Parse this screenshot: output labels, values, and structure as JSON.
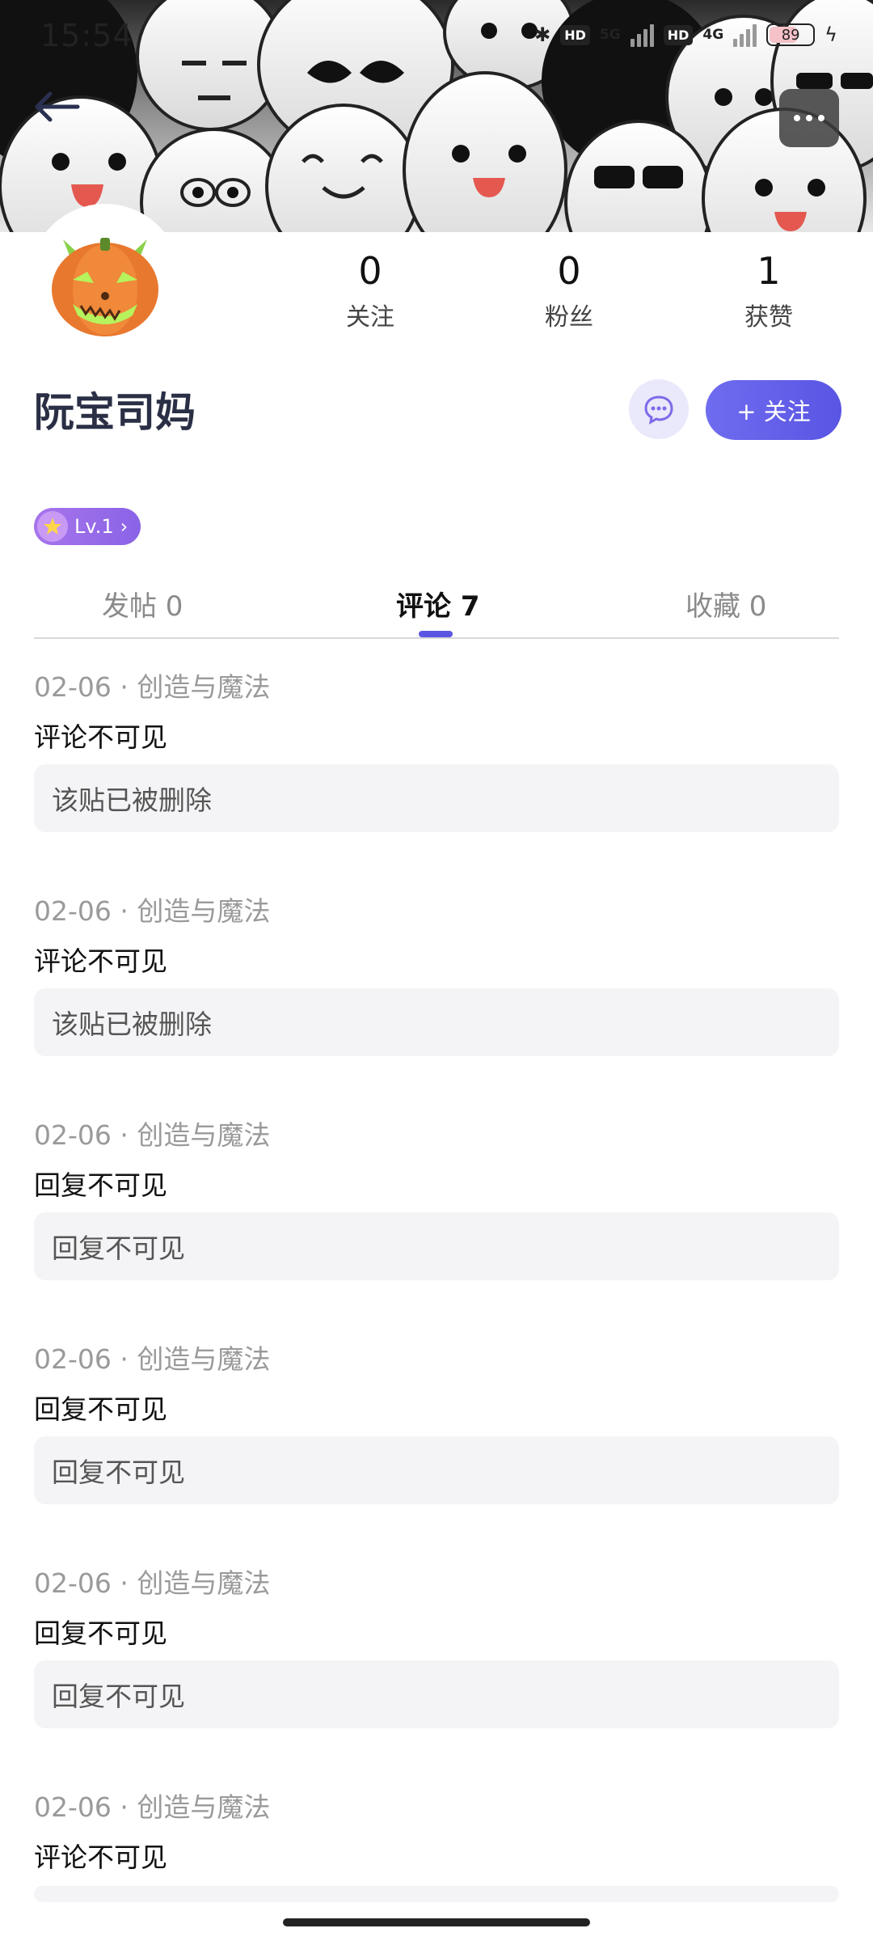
{
  "status_bar": {
    "time": "15:54",
    "net_1": "5G",
    "net_2": "4G",
    "hd_label": "HD",
    "battery": "89"
  },
  "header": {
    "back_icon": "arrow-left-icon",
    "more_icon": "more-dots-icon"
  },
  "profile": {
    "username": "阮宝司妈",
    "avatar": "pumpkin-cat-avatar",
    "level": "Lv.1",
    "level_chevron": "›",
    "follow_label": "+ 关注",
    "chat_icon": "chat-bubble-icon",
    "stats": [
      {
        "value": "0",
        "label": "关注"
      },
      {
        "value": "0",
        "label": "粉丝"
      },
      {
        "value": "1",
        "label": "获赞"
      }
    ]
  },
  "tabs": [
    {
      "label": "发帖 0",
      "active": false
    },
    {
      "label": "评论 7",
      "active": true
    },
    {
      "label": "收藏 0",
      "active": false
    }
  ],
  "comments": [
    {
      "meta": "02-06 · 创造与魔法",
      "text": "评论不可见",
      "quote": "该贴已被删除"
    },
    {
      "meta": "02-06 · 创造与魔法",
      "text": "评论不可见",
      "quote": "该贴已被删除"
    },
    {
      "meta": "02-06 · 创造与魔法",
      "text": "回复不可见",
      "quote": "回复不可见"
    },
    {
      "meta": "02-06 · 创造与魔法",
      "text": "回复不可见",
      "quote": "回复不可见"
    },
    {
      "meta": "02-06 · 创造与魔法",
      "text": "回复不可见",
      "quote": "回复不可见"
    },
    {
      "meta": "02-06 · 创造与魔法",
      "text": "评论不可见",
      "quote": ""
    }
  ],
  "colors": {
    "accent": "#5a55e3",
    "level": "#8a63e6",
    "meta_text": "#9a9a9a"
  }
}
